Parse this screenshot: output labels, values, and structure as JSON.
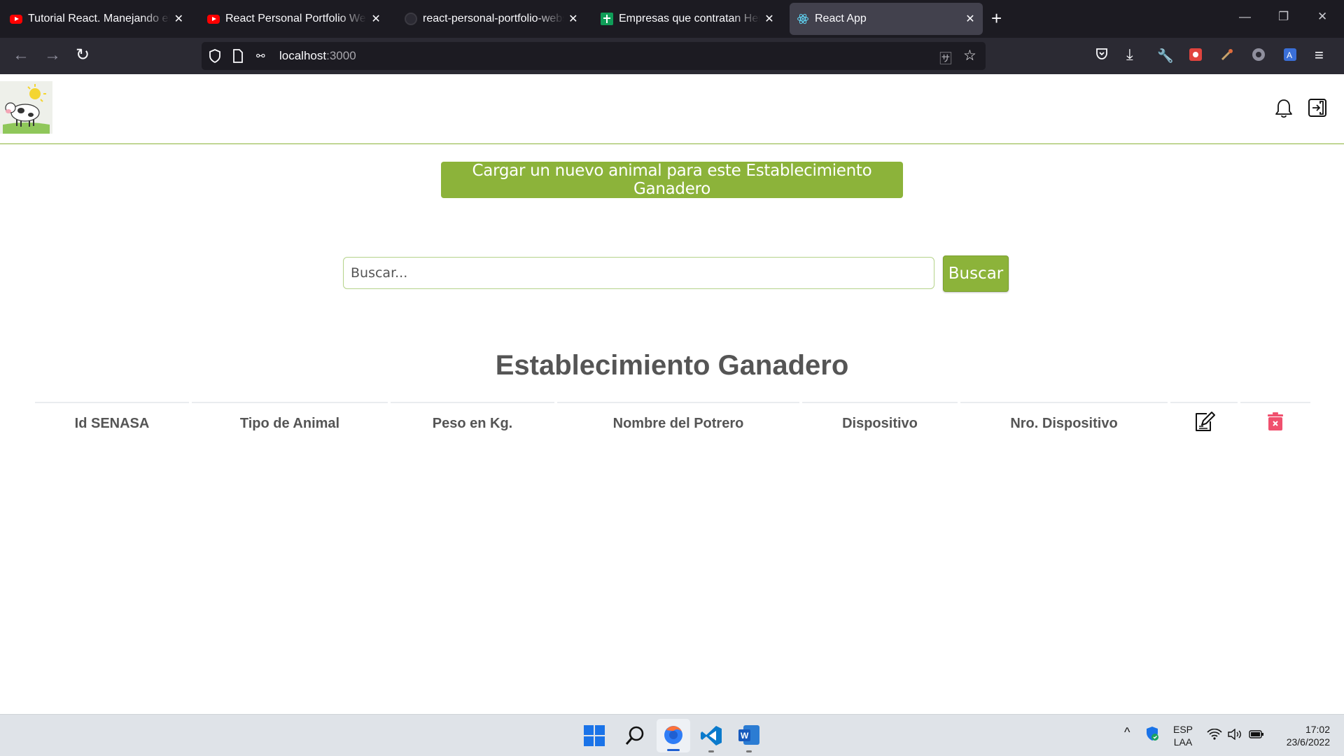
{
  "browser": {
    "tabs": [
      {
        "title": "Tutorial React. Manejando el estado",
        "icon": "youtube-icon"
      },
      {
        "title": "React Personal Portfolio Website",
        "icon": "youtube-icon"
      },
      {
        "title": "react-personal-portfolio-website",
        "icon": "github-icon"
      },
      {
        "title": "Empresas que contratan Henrys",
        "icon": "google-sheets-icon"
      },
      {
        "title": "React App",
        "icon": "react-icon",
        "active": true
      }
    ],
    "url_host": "localhost",
    "url_port": ":3000"
  },
  "app": {
    "load_button": "Cargar un nuevo animal para este Establecimiento Ganadero",
    "search": {
      "placeholder": "Buscar...",
      "value": "",
      "button": "Buscar"
    },
    "title": "Establecimiento Ganadero",
    "table": {
      "headers": [
        "Id SENASA",
        "Tipo de Animal",
        "Peso en Kg.",
        "Nombre del Potrero",
        "Dispositivo",
        "Nro. Dispositivo"
      ],
      "action_icons": [
        "edit-icon",
        "delete-icon"
      ],
      "rows": []
    },
    "colors": {
      "accent": "#8cb33a",
      "heading": "#555555",
      "delete": "#f0506e"
    }
  },
  "taskbar": {
    "language": "ESP",
    "layout": "LAA",
    "time": "17:02",
    "date": "23/6/2022"
  }
}
